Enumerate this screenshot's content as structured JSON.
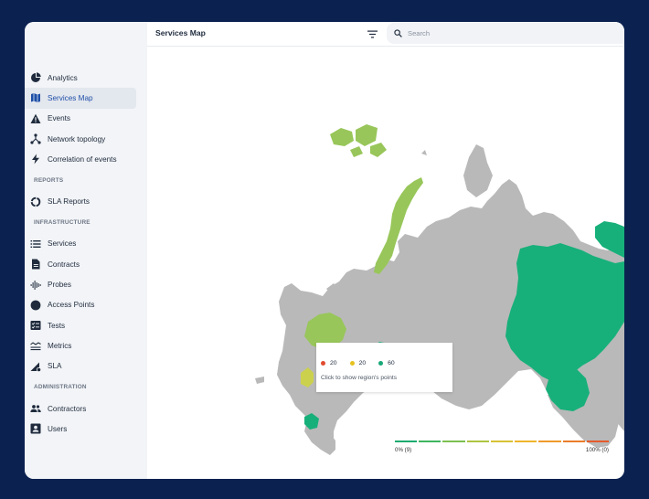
{
  "header": {
    "title": "Services Map",
    "search_placeholder": "Search",
    "filter_icon": "filter-icon",
    "search_icon": "search-icon"
  },
  "sidebar": {
    "items_top": [
      {
        "label": "Analytics",
        "icon": "pie-chart-icon",
        "active": false
      },
      {
        "label": "Services Map",
        "icon": "map-icon",
        "active": true
      },
      {
        "label": "Events",
        "icon": "warning-icon",
        "active": false
      },
      {
        "label": "Network topology",
        "icon": "topology-icon",
        "active": false
      },
      {
        "label": "Correlation of events",
        "icon": "bolt-icon",
        "active": false
      }
    ],
    "section_reports": "REPORTS",
    "items_reports": [
      {
        "label": "SLA Reports",
        "icon": "ring-icon",
        "active": false
      }
    ],
    "section_infrastructure": "INFRASTRUCTURE",
    "items_infrastructure": [
      {
        "label": "Services",
        "icon": "list-icon",
        "active": false
      },
      {
        "label": "Contracts",
        "icon": "document-icon",
        "active": false
      },
      {
        "label": "Probes",
        "icon": "waveform-icon",
        "active": false
      },
      {
        "label": "Access Points",
        "icon": "circle-icon",
        "active": false
      },
      {
        "label": "Tests",
        "icon": "checklist-icon",
        "active": false
      },
      {
        "label": "Metrics",
        "icon": "metrics-icon",
        "active": false
      },
      {
        "label": "SLA",
        "icon": "sla-icon",
        "active": false
      }
    ],
    "section_administration": "ADMINISTRATION",
    "items_administration": [
      {
        "label": "Contractors",
        "icon": "people-icon",
        "active": false
      },
      {
        "label": "Users",
        "icon": "user-card-icon",
        "active": false
      }
    ]
  },
  "map": {
    "tooltip": {
      "red_count": "20",
      "yellow_count": "20",
      "green_count": "60",
      "hint": "Click to show region's points"
    },
    "legend": {
      "min_label": "0% (9)",
      "max_label": "100% (0)",
      "colors": [
        "#1aaa6f",
        "#3fb55f",
        "#7cc050",
        "#aec441",
        "#d7c233",
        "#efb52c",
        "#ef9a2c",
        "#ea7d2b",
        "#e45b2b"
      ]
    },
    "colors": {
      "gray": "#b9b9b9",
      "green": "#17b07a",
      "light_green": "#98c65a",
      "yellow": "#ccd14d",
      "red_dot": "#e04b2f",
      "yellow_dot": "#e6c21e",
      "green_dot": "#19a877"
    }
  }
}
